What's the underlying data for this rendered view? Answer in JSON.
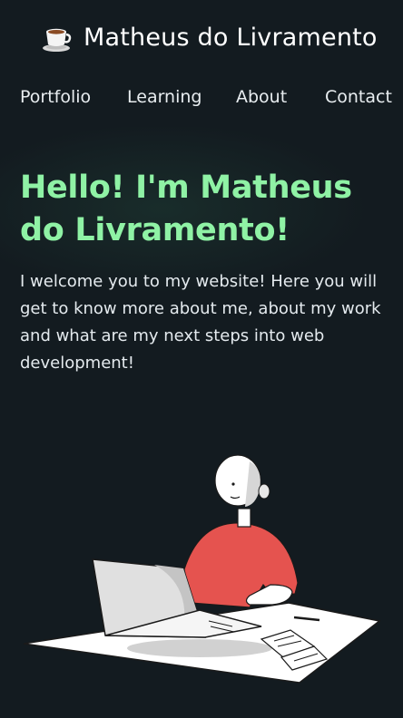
{
  "brand": {
    "name": "Matheus do Livramento",
    "icon": "coffee-cup-icon"
  },
  "nav": {
    "items": [
      {
        "label": "Portfolio"
      },
      {
        "label": "Learning"
      },
      {
        "label": "About"
      },
      {
        "label": "Contact"
      }
    ]
  },
  "hero": {
    "heading": "Hello! I'm Matheus do Livramento!",
    "intro": "I welcome you to my website! Here you will get to know more about me, about my work and what are my next steps into web development!"
  },
  "illustration": {
    "icon": "person-at-laptop-illustration"
  },
  "colors": {
    "background": "#131b20",
    "accent": "#8ff2a5",
    "text": "#e9eef1",
    "shirt": "#e5534f"
  }
}
